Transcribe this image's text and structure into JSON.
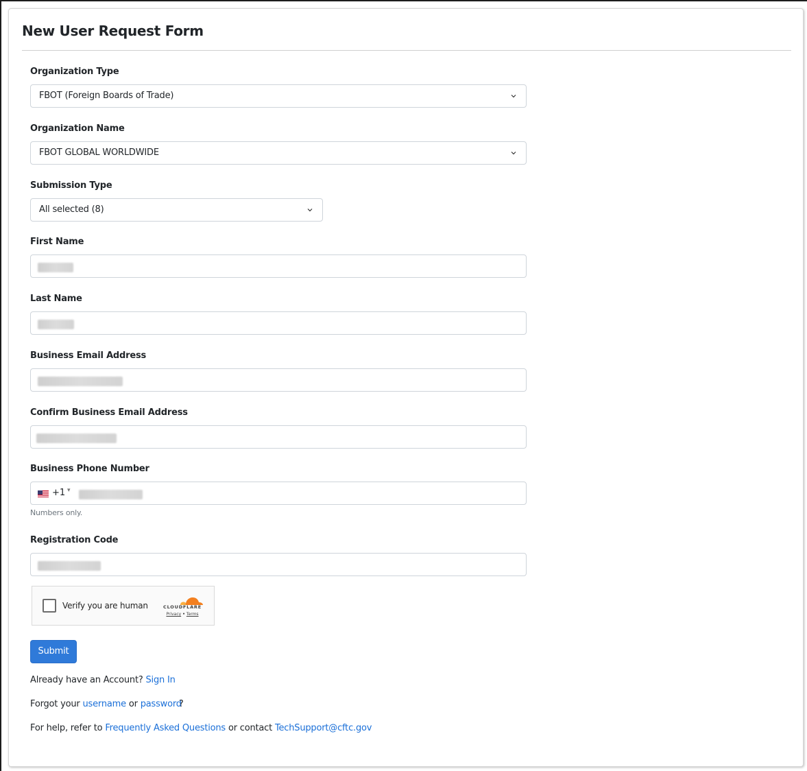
{
  "form": {
    "title": "New User Request Form",
    "organization_type": {
      "label": "Organization Type",
      "value": "FBOT (Foreign Boards of Trade)"
    },
    "organization_name": {
      "label": "Organization Name",
      "value": "FBOT GLOBAL WORLDWIDE"
    },
    "submission_type": {
      "label": "Submission Type",
      "value": "All selected (8)"
    },
    "first_name": {
      "label": "First Name"
    },
    "last_name": {
      "label": "Last Name"
    },
    "business_email": {
      "label": "Business Email Address"
    },
    "confirm_email": {
      "label": "Confirm Business Email Address"
    },
    "business_phone": {
      "label": "Business Phone Number",
      "dial_code": "+1",
      "hint": "Numbers only."
    },
    "registration_code": {
      "label": "Registration Code"
    },
    "captcha": {
      "label": "Verify you are human",
      "brand": "CLOUDFLARE",
      "privacy": "Privacy",
      "separator": "•",
      "terms": "Terms"
    },
    "submit_label": "Submit"
  },
  "footer": {
    "account_prefix": "Already have an Account?",
    "sign_in": "Sign In",
    "forgot_prefix": "Forgot your",
    "username": "username",
    "or": "or",
    "password": "password",
    "question_mark": "?",
    "help_prefix": "For help, refer to",
    "faq": "Frequently Asked Questions",
    "or_contact": "or contact",
    "email": "TechSupport@cftc.gov"
  },
  "icons": {
    "dropdown": "chevron-down-icon",
    "flag": "us-flag-icon",
    "cloud": "cloudflare-cloud-icon"
  },
  "colors": {
    "primary": "#2f7ad9",
    "link": "#1a6fd8",
    "cloudflare_orange": "#f38020"
  }
}
